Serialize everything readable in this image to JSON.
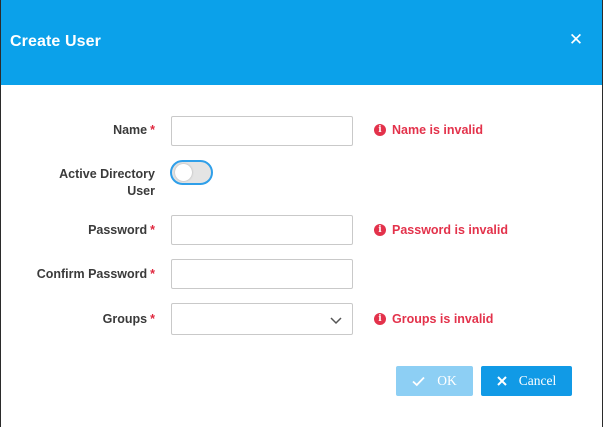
{
  "dialog": {
    "title": "Create User",
    "close_glyph": "✕"
  },
  "form": {
    "name": {
      "label": "Name",
      "required": "*",
      "value": "",
      "error": "Name is invalid"
    },
    "active_directory": {
      "label_line1": "Active Directory",
      "label_line2": "User",
      "enabled": false
    },
    "password": {
      "label": "Password",
      "required": "*",
      "value": "",
      "error": "Password is invalid"
    },
    "confirm_password": {
      "label": "Confirm Password",
      "required": "*",
      "value": ""
    },
    "groups": {
      "label": "Groups",
      "required": "*",
      "value": "",
      "error": "Groups is invalid"
    }
  },
  "icons": {
    "error": "error-info-icon",
    "chevron": "chevron-down-icon",
    "ok": "check-icon",
    "cancel": "close-icon"
  },
  "buttons": {
    "ok_label": "OK",
    "cancel_label": "Cancel",
    "ok_disabled": true
  },
  "colors": {
    "header": "#0ba1ea",
    "error": "#e3324b",
    "required": "#e0283f",
    "ok_disabled": "#8dcff4",
    "cancel": "#119ae6",
    "toggle_border": "#2f9fe9"
  }
}
